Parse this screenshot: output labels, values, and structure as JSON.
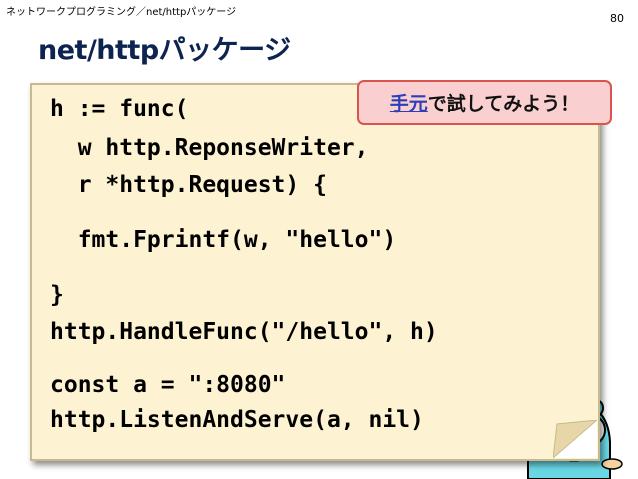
{
  "header": {
    "breadcrumb": "ネットワークプログラミング／net/httpパッケージ",
    "page_number": "80",
    "title": "net/httpパッケージ"
  },
  "code": {
    "lines": [
      "h := func(",
      "  w http.ReponseWriter,",
      "  r *http.Request) {",
      "  fmt.Fprintf(w, \"hello\")",
      "}",
      "http.HandleFunc(\"/hello\", h)",
      "const a = \":8080\"",
      "http.ListenAndServe(a, nil)"
    ]
  },
  "callout": {
    "link_text": "手元",
    "text": "で試してみよう！"
  },
  "colors": {
    "title": "#0d2350",
    "card_bg": "#fdf3d2",
    "callout_bg": "#f9cfcf",
    "callout_border": "#d9534f",
    "link": "#2b3fb8",
    "gopher": "#6ad7e5"
  }
}
